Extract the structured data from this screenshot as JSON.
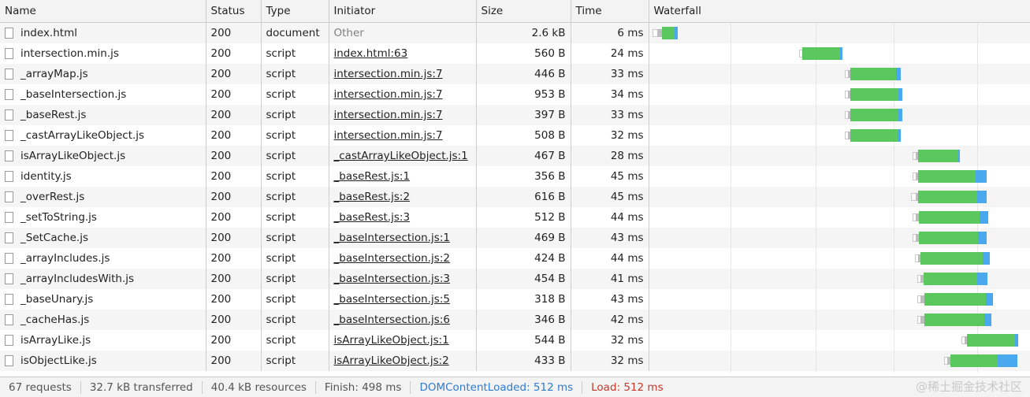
{
  "columns": [
    "Name",
    "Status",
    "Type",
    "Initiator",
    "Size",
    "Time",
    "Waterfall"
  ],
  "requests": [
    {
      "name": "index.html",
      "status": "200",
      "type": "document",
      "initiator": "Other",
      "initiator_link": false,
      "size": "2.6 kB",
      "time": "6 ms"
    },
    {
      "name": "intersection.min.js",
      "status": "200",
      "type": "script",
      "initiator": "index.html:63",
      "initiator_link": true,
      "size": "560 B",
      "time": "24 ms"
    },
    {
      "name": "_arrayMap.js",
      "status": "200",
      "type": "script",
      "initiator": "intersection.min.js:7",
      "initiator_link": true,
      "size": "446 B",
      "time": "33 ms"
    },
    {
      "name": "_baseIntersection.js",
      "status": "200",
      "type": "script",
      "initiator": "intersection.min.js:7",
      "initiator_link": true,
      "size": "953 B",
      "time": "34 ms"
    },
    {
      "name": "_baseRest.js",
      "status": "200",
      "type": "script",
      "initiator": "intersection.min.js:7",
      "initiator_link": true,
      "size": "397 B",
      "time": "33 ms"
    },
    {
      "name": "_castArrayLikeObject.js",
      "status": "200",
      "type": "script",
      "initiator": "intersection.min.js:7",
      "initiator_link": true,
      "size": "508 B",
      "time": "32 ms"
    },
    {
      "name": "isArrayLikeObject.js",
      "status": "200",
      "type": "script",
      "initiator": "_castArrayLikeObject.js:1",
      "initiator_link": true,
      "size": "467 B",
      "time": "28 ms"
    },
    {
      "name": "identity.js",
      "status": "200",
      "type": "script",
      "initiator": "_baseRest.js:1",
      "initiator_link": true,
      "size": "356 B",
      "time": "45 ms"
    },
    {
      "name": "_overRest.js",
      "status": "200",
      "type": "script",
      "initiator": "_baseRest.js:2",
      "initiator_link": true,
      "size": "616 B",
      "time": "45 ms"
    },
    {
      "name": "_setToString.js",
      "status": "200",
      "type": "script",
      "initiator": "_baseRest.js:3",
      "initiator_link": true,
      "size": "512 B",
      "time": "44 ms"
    },
    {
      "name": "_SetCache.js",
      "status": "200",
      "type": "script",
      "initiator": "_baseIntersection.js:1",
      "initiator_link": true,
      "size": "469 B",
      "time": "43 ms"
    },
    {
      "name": "_arrayIncludes.js",
      "status": "200",
      "type": "script",
      "initiator": "_baseIntersection.js:2",
      "initiator_link": true,
      "size": "424 B",
      "time": "44 ms"
    },
    {
      "name": "_arrayIncludesWith.js",
      "status": "200",
      "type": "script",
      "initiator": "_baseIntersection.js:3",
      "initiator_link": true,
      "size": "454 B",
      "time": "41 ms"
    },
    {
      "name": "_baseUnary.js",
      "status": "200",
      "type": "script",
      "initiator": "_baseIntersection.js:5",
      "initiator_link": true,
      "size": "318 B",
      "time": "43 ms"
    },
    {
      "name": "_cacheHas.js",
      "status": "200",
      "type": "script",
      "initiator": "_baseIntersection.js:6",
      "initiator_link": true,
      "size": "346 B",
      "time": "42 ms"
    },
    {
      "name": "isArrayLike.js",
      "status": "200",
      "type": "script",
      "initiator": "isArrayLikeObject.js:1",
      "initiator_link": true,
      "size": "544 B",
      "time": "32 ms"
    },
    {
      "name": "isObjectLike.js",
      "status": "200",
      "type": "script",
      "initiator": "isArrayLikeObject.js:2",
      "initiator_link": true,
      "size": "433 B",
      "time": "32 ms"
    }
  ],
  "status_bar": {
    "requests": "67 requests",
    "transferred": "32.7 kB transferred",
    "resources": "40.4 kB resources",
    "finish": "Finish: 498 ms",
    "dom_content_loaded": "DOMContentLoaded: 512 ms",
    "load": "Load: 512 ms"
  },
  "watermark": "@稀土掘金技术社区",
  "colors": {
    "content_download": "#5ac85f",
    "waiting": "#4aa8ee",
    "dom_content_loaded": "#2e7bd0",
    "load": "#c8372b"
  },
  "icons": {
    "request_row": "file-icon"
  }
}
